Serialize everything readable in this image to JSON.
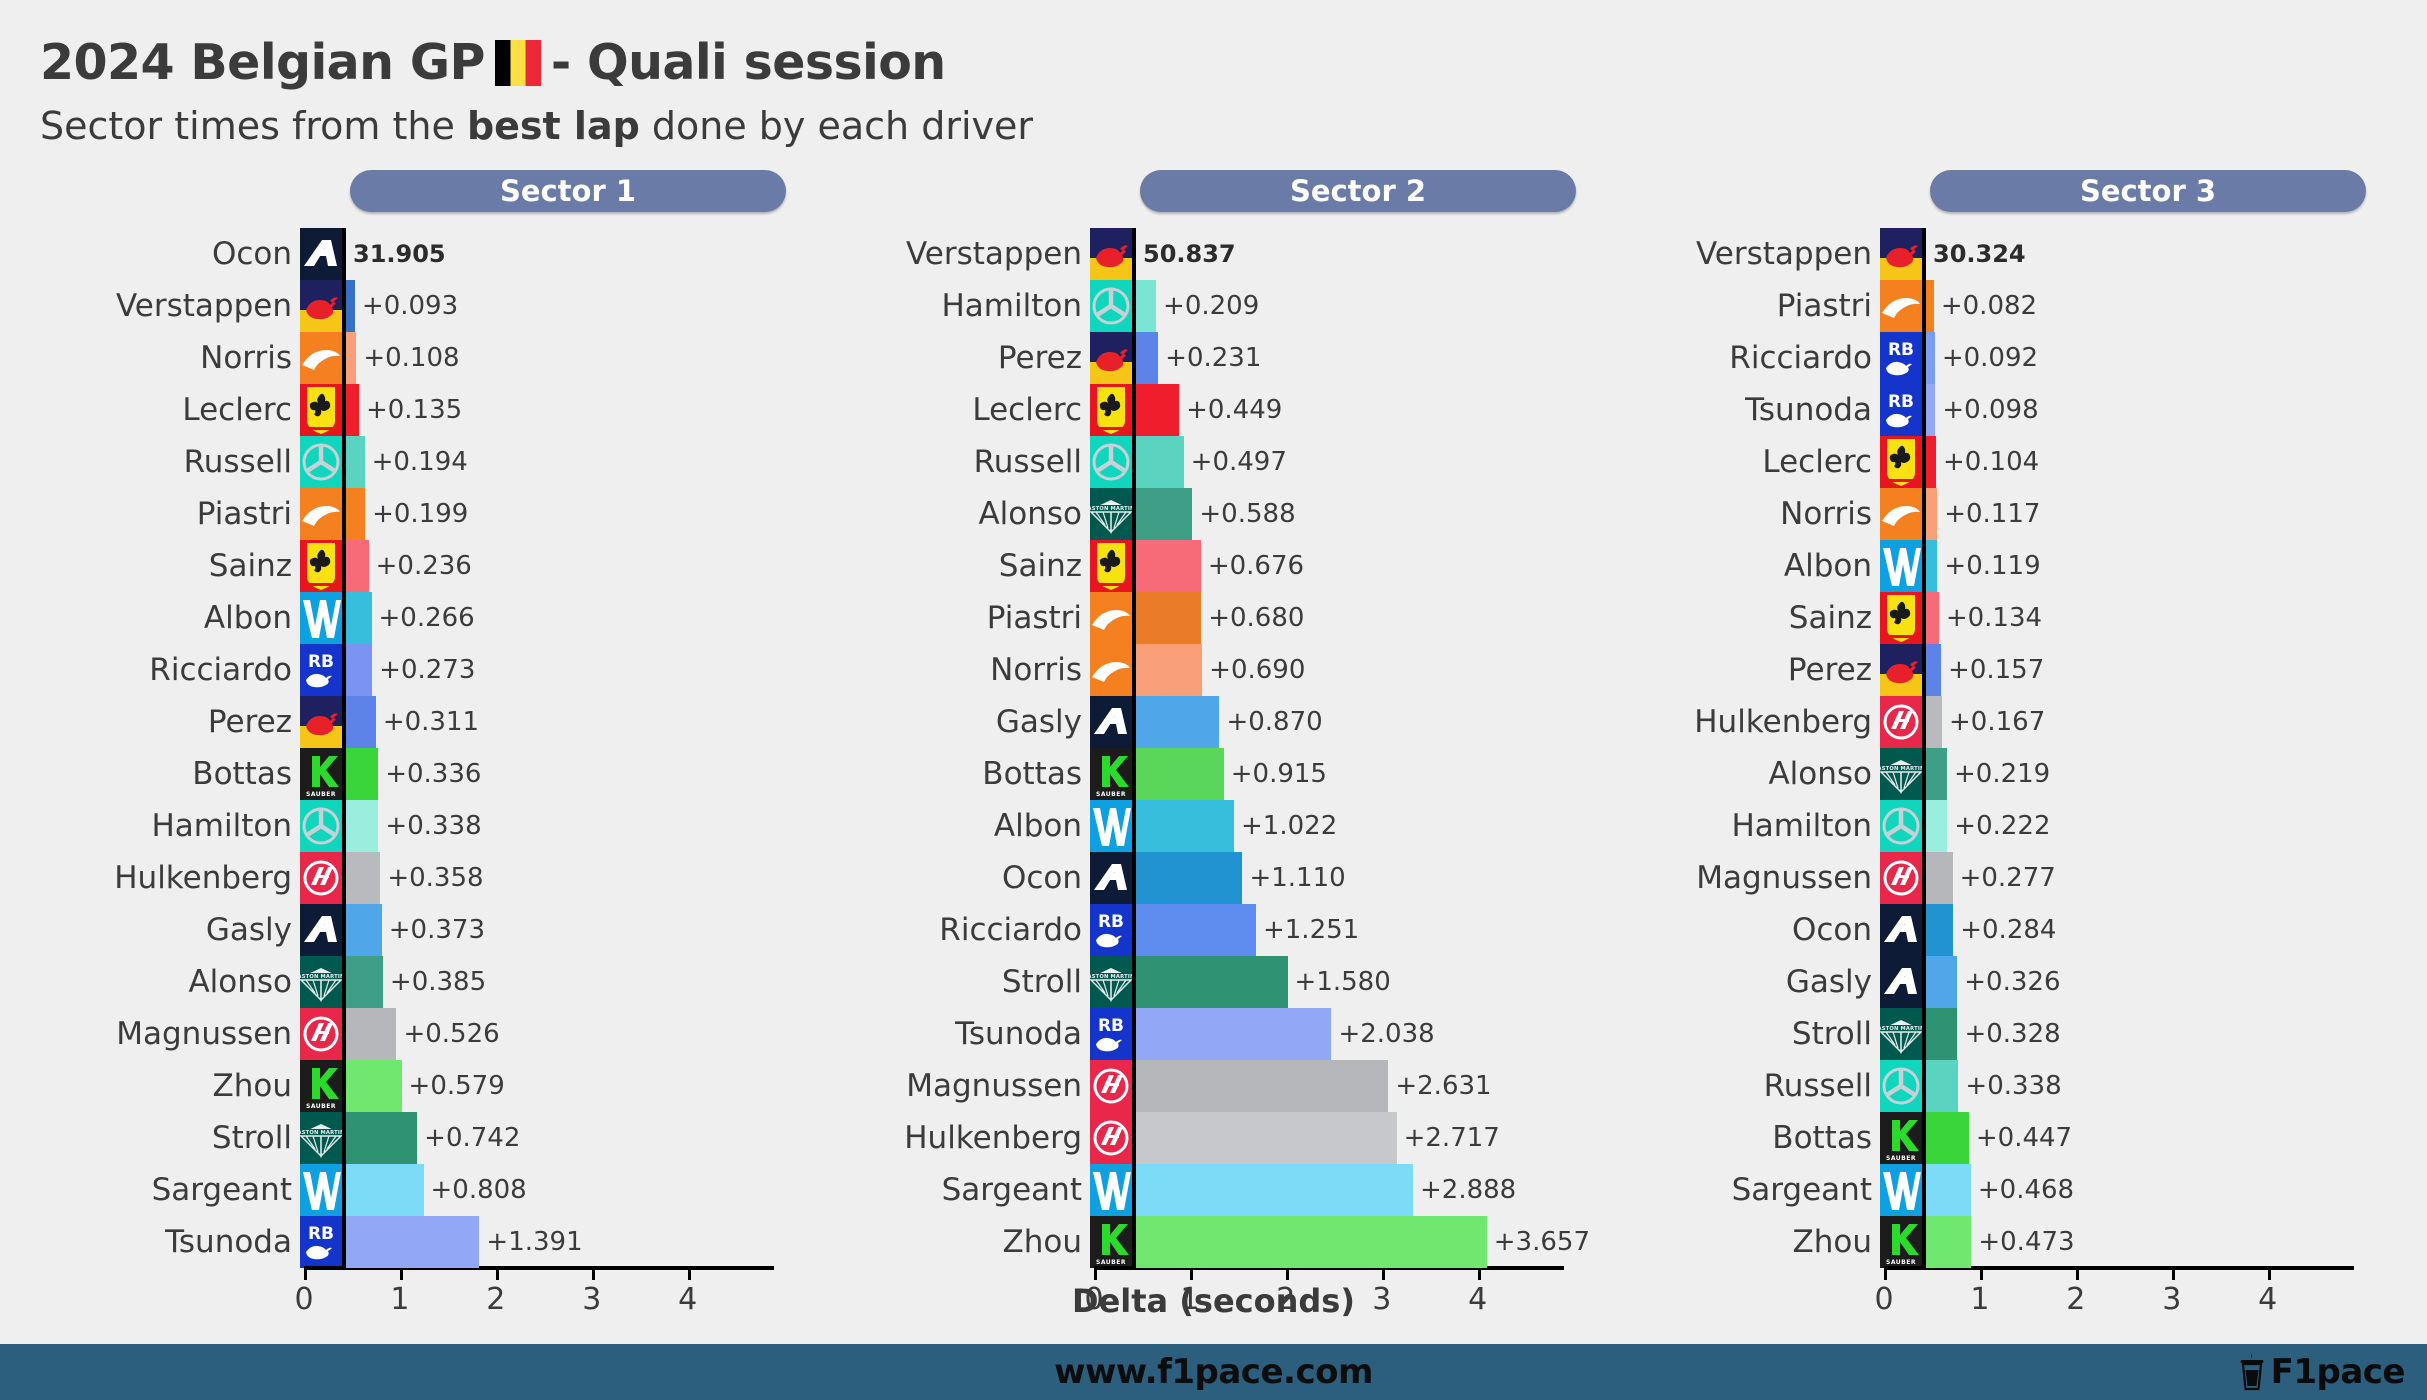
{
  "header": {
    "title_before_flag": "2024 Belgian GP",
    "flag": "belgium-flag",
    "title_after_flag": "- Quali session",
    "subtitle_pre": "Sector times from the ",
    "subtitle_bold": "best lap",
    "subtitle_post": " done by each driver"
  },
  "axis": {
    "xlabel": "Delta (seconds)",
    "ticks": [
      "0",
      "1",
      "2",
      "3",
      "4"
    ],
    "xlim": [
      0,
      4.9
    ]
  },
  "footer": {
    "url": "www.f1pace.com",
    "brand": "F1pace",
    "brand_icon": "coffee-cup-icon"
  },
  "colors": {
    "banner": "#6b7ba8",
    "footer": "#2c5e7e",
    "background": "#efeff0",
    "text": "#3b3b3b"
  },
  "chart_data": {
    "type": "bar",
    "title": "2024 Belgian GP - Quali session",
    "subtitle": "Sector times from the best lap done by each driver",
    "xlabel": "Delta (seconds)",
    "ylabel": "",
    "xlim": [
      0,
      4.9
    ],
    "xticks": [
      0,
      1,
      2,
      3,
      4
    ],
    "grid": false,
    "orientation": "horizontal",
    "panels": [
      {
        "name": "Sector 1",
        "leader_time": "31.905",
        "rows": [
          {
            "driver": "Ocon",
            "team": "alpine",
            "label": "31.905",
            "value": 0,
            "color": "#2293d1",
            "leader": true
          },
          {
            "driver": "Verstappen",
            "team": "red-bull",
            "label": "+0.093",
            "value": 0.093,
            "color": "#3671c6",
            "leader": false
          },
          {
            "driver": "Norris",
            "team": "mclaren",
            "label": "+0.108",
            "value": 0.108,
            "color": "#f9a07a",
            "leader": false
          },
          {
            "driver": "Leclerc",
            "team": "ferrari",
            "label": "+0.135",
            "value": 0.135,
            "color": "#f01e2c",
            "leader": false
          },
          {
            "driver": "Russell",
            "team": "mercedes",
            "label": "+0.194",
            "value": 0.194,
            "color": "#5ad4c0",
            "leader": false
          },
          {
            "driver": "Piastri",
            "team": "mclaren",
            "label": "+0.199",
            "value": 0.199,
            "color": "#f58020",
            "leader": false
          },
          {
            "driver": "Sainz",
            "team": "ferrari",
            "label": "+0.236",
            "value": 0.236,
            "color": "#f76b78",
            "leader": false
          },
          {
            "driver": "Albon",
            "team": "williams",
            "label": "+0.266",
            "value": 0.266,
            "color": "#37bedd",
            "leader": false
          },
          {
            "driver": "Ricciardo",
            "team": "rb",
            "label": "+0.273",
            "value": 0.273,
            "color": "#7b94f3",
            "leader": false
          },
          {
            "driver": "Perez",
            "team": "red-bull",
            "label": "+0.311",
            "value": 0.311,
            "color": "#5e83e8",
            "leader": false
          },
          {
            "driver": "Bottas",
            "team": "sauber",
            "label": "+0.336",
            "value": 0.336,
            "color": "#3ad53a",
            "leader": false
          },
          {
            "driver": "Hamilton",
            "team": "mercedes",
            "label": "+0.338",
            "value": 0.338,
            "color": "#9aeedd",
            "leader": false
          },
          {
            "driver": "Hulkenberg",
            "team": "haas",
            "label": "+0.358",
            "value": 0.358,
            "color": "#b8babd",
            "leader": false
          },
          {
            "driver": "Gasly",
            "team": "alpine",
            "label": "+0.373",
            "value": 0.373,
            "color": "#4fa6e8",
            "leader": false
          },
          {
            "driver": "Alonso",
            "team": "aston-martin",
            "label": "+0.385",
            "value": 0.385,
            "color": "#3f9e86",
            "leader": false
          },
          {
            "driver": "Magnussen",
            "team": "haas",
            "label": "+0.526",
            "value": 0.526,
            "color": "#b5b7ba",
            "leader": false
          },
          {
            "driver": "Zhou",
            "team": "sauber",
            "label": "+0.579",
            "value": 0.579,
            "color": "#70e870",
            "leader": false
          },
          {
            "driver": "Stroll",
            "team": "aston-martin",
            "label": "+0.742",
            "value": 0.742,
            "color": "#2f9272",
            "leader": false
          },
          {
            "driver": "Sargeant",
            "team": "williams",
            "label": "+0.808",
            "value": 0.808,
            "color": "#7cdcf7",
            "leader": false
          },
          {
            "driver": "Tsunoda",
            "team": "rb",
            "label": "+1.391",
            "value": 1.391,
            "color": "#93a7f7",
            "leader": false
          }
        ]
      },
      {
        "name": "Sector 2",
        "leader_time": "50.837",
        "rows": [
          {
            "driver": "Verstappen",
            "team": "red-bull",
            "label": "50.837",
            "value": 0,
            "color": "#3671c6",
            "leader": true
          },
          {
            "driver": "Hamilton",
            "team": "mercedes",
            "label": "+0.209",
            "value": 0.209,
            "color": "#7ae5d3",
            "leader": false
          },
          {
            "driver": "Perez",
            "team": "red-bull",
            "label": "+0.231",
            "value": 0.231,
            "color": "#5e83e8",
            "leader": false
          },
          {
            "driver": "Leclerc",
            "team": "ferrari",
            "label": "+0.449",
            "value": 0.449,
            "color": "#f01e2c",
            "leader": false
          },
          {
            "driver": "Russell",
            "team": "mercedes",
            "label": "+0.497",
            "value": 0.497,
            "color": "#5ad4c0",
            "leader": false
          },
          {
            "driver": "Alonso",
            "team": "aston-martin",
            "label": "+0.588",
            "value": 0.588,
            "color": "#3f9e86",
            "leader": false
          },
          {
            "driver": "Sainz",
            "team": "ferrari",
            "label": "+0.676",
            "value": 0.676,
            "color": "#f76b78",
            "leader": false
          },
          {
            "driver": "Piastri",
            "team": "mclaren",
            "label": "+0.680",
            "value": 0.68,
            "color": "#ea7b28",
            "leader": false
          },
          {
            "driver": "Norris",
            "team": "mclaren",
            "label": "+0.690",
            "value": 0.69,
            "color": "#f9a07a",
            "leader": false
          },
          {
            "driver": "Gasly",
            "team": "alpine",
            "label": "+0.870",
            "value": 0.87,
            "color": "#4fa6e8",
            "leader": false
          },
          {
            "driver": "Bottas",
            "team": "sauber",
            "label": "+0.915",
            "value": 0.915,
            "color": "#5ad75a",
            "leader": false
          },
          {
            "driver": "Albon",
            "team": "williams",
            "label": "+1.022",
            "value": 1.022,
            "color": "#37bedd",
            "leader": false
          },
          {
            "driver": "Ocon",
            "team": "alpine",
            "label": "+1.110",
            "value": 1.11,
            "color": "#2293d1",
            "leader": false
          },
          {
            "driver": "Ricciardo",
            "team": "rb",
            "label": "+1.251",
            "value": 1.251,
            "color": "#5e8cef",
            "leader": false
          },
          {
            "driver": "Stroll",
            "team": "aston-martin",
            "label": "+1.580",
            "value": 1.58,
            "color": "#2f9272",
            "leader": false
          },
          {
            "driver": "Tsunoda",
            "team": "rb",
            "label": "+2.038",
            "value": 2.038,
            "color": "#93a7f7",
            "leader": false
          },
          {
            "driver": "Magnussen",
            "team": "haas",
            "label": "+2.631",
            "value": 2.631,
            "color": "#b5b7ba",
            "leader": false
          },
          {
            "driver": "Hulkenberg",
            "team": "haas",
            "label": "+2.717",
            "value": 2.717,
            "color": "#c6c8cb",
            "leader": false
          },
          {
            "driver": "Sargeant",
            "team": "williams",
            "label": "+2.888",
            "value": 2.888,
            "color": "#7cdcf7",
            "leader": false
          },
          {
            "driver": "Zhou",
            "team": "sauber",
            "label": "+3.657",
            "value": 3.657,
            "color": "#70e870",
            "leader": false
          }
        ]
      },
      {
        "name": "Sector 3",
        "leader_time": "30.324",
        "rows": [
          {
            "driver": "Verstappen",
            "team": "red-bull",
            "label": "30.324",
            "value": 0,
            "color": "#3671c6",
            "leader": true
          },
          {
            "driver": "Piastri",
            "team": "mclaren",
            "label": "+0.082",
            "value": 0.082,
            "color": "#f58020",
            "leader": false
          },
          {
            "driver": "Ricciardo",
            "team": "rb",
            "label": "+0.092",
            "value": 0.092,
            "color": "#7b9ef3",
            "leader": false
          },
          {
            "driver": "Tsunoda",
            "team": "rb",
            "label": "+0.098",
            "value": 0.098,
            "color": "#93a7f7",
            "leader": false
          },
          {
            "driver": "Leclerc",
            "team": "ferrari",
            "label": "+0.104",
            "value": 0.104,
            "color": "#f01e2c",
            "leader": false
          },
          {
            "driver": "Norris",
            "team": "mclaren",
            "label": "+0.117",
            "value": 0.117,
            "color": "#f9a07a",
            "leader": false
          },
          {
            "driver": "Albon",
            "team": "williams",
            "label": "+0.119",
            "value": 0.119,
            "color": "#37bedd",
            "leader": false
          },
          {
            "driver": "Sainz",
            "team": "ferrari",
            "label": "+0.134",
            "value": 0.134,
            "color": "#f76b78",
            "leader": false
          },
          {
            "driver": "Perez",
            "team": "red-bull",
            "label": "+0.157",
            "value": 0.157,
            "color": "#5e83e8",
            "leader": false
          },
          {
            "driver": "Hulkenberg",
            "team": "haas",
            "label": "+0.167",
            "value": 0.167,
            "color": "#b8babd",
            "leader": false
          },
          {
            "driver": "Alonso",
            "team": "aston-martin",
            "label": "+0.219",
            "value": 0.219,
            "color": "#3f9e86",
            "leader": false
          },
          {
            "driver": "Hamilton",
            "team": "mercedes",
            "label": "+0.222",
            "value": 0.222,
            "color": "#9aeedd",
            "leader": false
          },
          {
            "driver": "Magnussen",
            "team": "haas",
            "label": "+0.277",
            "value": 0.277,
            "color": "#b5b7ba",
            "leader": false
          },
          {
            "driver": "Ocon",
            "team": "alpine",
            "label": "+0.284",
            "value": 0.284,
            "color": "#2293d1",
            "leader": false
          },
          {
            "driver": "Gasly",
            "team": "alpine",
            "label": "+0.326",
            "value": 0.326,
            "color": "#4fa6e8",
            "leader": false
          },
          {
            "driver": "Stroll",
            "team": "aston-martin",
            "label": "+0.328",
            "value": 0.328,
            "color": "#2f9272",
            "leader": false
          },
          {
            "driver": "Russell",
            "team": "mercedes",
            "label": "+0.338",
            "value": 0.338,
            "color": "#5ad4c0",
            "leader": false
          },
          {
            "driver": "Bottas",
            "team": "sauber",
            "label": "+0.447",
            "value": 0.447,
            "color": "#3ad53a",
            "leader": false
          },
          {
            "driver": "Sargeant",
            "team": "williams",
            "label": "+0.468",
            "value": 0.468,
            "color": "#7cdcf7",
            "leader": false
          },
          {
            "driver": "Zhou",
            "team": "sauber",
            "label": "+0.473",
            "value": 0.473,
            "color": "#70e870",
            "leader": false
          }
        ]
      }
    ]
  }
}
